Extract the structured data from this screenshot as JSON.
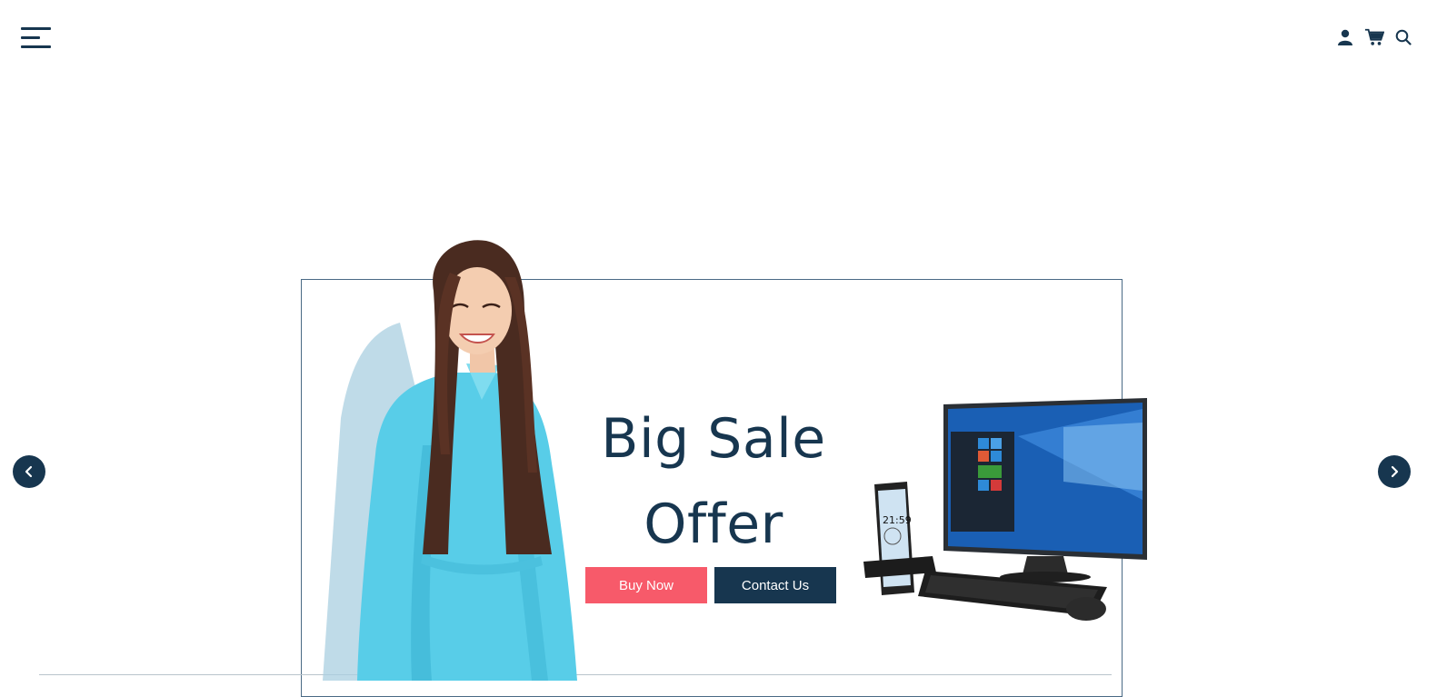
{
  "header": {
    "menu_icon": "hamburger-menu-icon",
    "icons": [
      "user-icon",
      "cart-icon",
      "search-icon"
    ]
  },
  "hero": {
    "headline_line1": "Big Sale",
    "headline_line2": "Offer",
    "buy_now_label": "Buy Now",
    "contact_label": "Contact Us"
  },
  "carousel": {
    "prev_icon": "chevron-left-icon",
    "next_icon": "chevron-right-icon"
  },
  "colors": {
    "navy": "#17364f",
    "coral": "#f75a6a",
    "shirt": "#58cde8",
    "background": "#ffffff"
  }
}
